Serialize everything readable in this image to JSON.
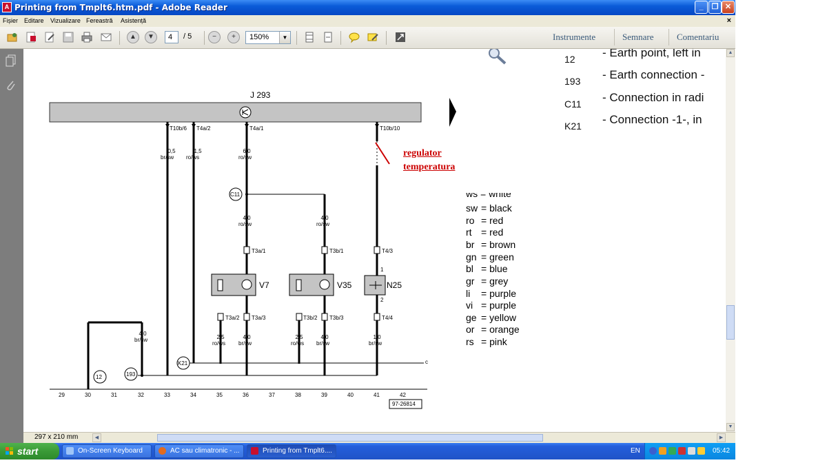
{
  "window": {
    "title": "Printing from Tmplt6.htm.pdf - Adobe Reader",
    "app_icon_glyph": "A",
    "minimize_glyph": "_",
    "maximize_glyph": "❐",
    "close_glyph": "✕"
  },
  "menu": {
    "items": [
      "Fișier",
      "Editare",
      "Vizualizare",
      "Fereastră",
      "Asistență"
    ],
    "close_glyph": "×"
  },
  "toolbar": {
    "page_current": "4",
    "page_total": "/ 5",
    "zoom": "150%",
    "right_links": [
      "Instrumente",
      "Semnare",
      "Comentariu"
    ],
    "icons": [
      "open-icon",
      "create-pdf-icon",
      "edit-icon",
      "save-icon",
      "print-icon",
      "email-icon",
      "prev-page-icon",
      "next-page-icon",
      "zoom-out-icon",
      "zoom-in-icon",
      "fit-page-icon",
      "fit-width-icon",
      "comment-icon",
      "sign-icon",
      "fullscreen-icon"
    ]
  },
  "statusbar": {
    "page_size": "297 x 210 mm"
  },
  "document": {
    "component_top": "J 293",
    "red_note_line1": "regulator",
    "red_note_line2": "temperatura",
    "connectors_top": [
      "T10b/6",
      "T4a/2",
      "T4a/1",
      "T10b/10"
    ],
    "wires_top": [
      {
        "gauge": "0,5",
        "color": "br/sw"
      },
      {
        "gauge": "1,5",
        "color": "ro/ws"
      },
      {
        "gauge": "6,0",
        "color": "ro/sw"
      }
    ],
    "junction_c11": "C11",
    "wires_mid": [
      {
        "gauge": "4,0",
        "color": "ro/sw"
      },
      {
        "gauge": "4,0",
        "color": "ro/sw"
      }
    ],
    "connectors_mid": [
      "T3a/1",
      "T3b/1",
      "T4/3"
    ],
    "components": [
      "V7",
      "V35",
      "N25"
    ],
    "n25_pin_top": "1",
    "n25_pin_bottom": "2",
    "connectors_low": [
      "T3a/2",
      "T3a/3",
      "T3b/2",
      "T3b/3",
      "T4/4"
    ],
    "wires_low": [
      {
        "gauge": "4,0",
        "color": "br/sw"
      },
      {
        "gauge": "2,5",
        "color": "ro/ws"
      },
      {
        "gauge": "4,0",
        "color": "br/sw"
      },
      {
        "gauge": "2,5",
        "color": "ro/ws"
      },
      {
        "gauge": "4,0",
        "color": "br/sw"
      },
      {
        "gauge": "1,0",
        "color": "br/sw"
      }
    ],
    "junctions_bottom": [
      "12",
      "193",
      "K21"
    ],
    "edge_letter": "c",
    "grid_numbers": [
      "29",
      "30",
      "31",
      "32",
      "33",
      "34",
      "35",
      "36",
      "37",
      "38",
      "39",
      "40",
      "41",
      "42"
    ],
    "ref_code": "97-26814",
    "earth_list": [
      {
        "code": "12",
        "text": "-  Earth point, left in"
      },
      {
        "code": "193",
        "text": "-  Earth connection -"
      },
      {
        "code": "C11",
        "text": "-  Connection in radi"
      },
      {
        "code": "K21",
        "text": "-  Connection -1-, in"
      }
    ],
    "legend_partial": "ws  =  white",
    "color_legend": [
      {
        "k": "sw",
        "v": "=  black"
      },
      {
        "k": "ro",
        "v": "=  red"
      },
      {
        "k": "rt",
        "v": "=  red"
      },
      {
        "k": "br",
        "v": "=  brown"
      },
      {
        "k": "gn",
        "v": "=  green"
      },
      {
        "k": "bl",
        "v": "=  blue"
      },
      {
        "k": "gr",
        "v": "=  grey"
      },
      {
        "k": "li",
        "v": "=  purple"
      },
      {
        "k": "vi",
        "v": "=  purple"
      },
      {
        "k": "ge",
        "v": "=  yellow"
      },
      {
        "k": "or",
        "v": "=  orange"
      },
      {
        "k": "rs",
        "v": "=  pink"
      }
    ]
  },
  "taskbar": {
    "start": "start",
    "tasks": [
      "On-Screen Keyboard",
      "AC sau climatronic - ...",
      "Printing from Tmplt6...."
    ],
    "language": "EN",
    "clock": "05:42"
  },
  "colors": {
    "accent_red": "#cc0000",
    "titlebar_blue": "#0a5bd8",
    "taskbar_blue": "#245edb",
    "start_green": "#3a9a36"
  }
}
